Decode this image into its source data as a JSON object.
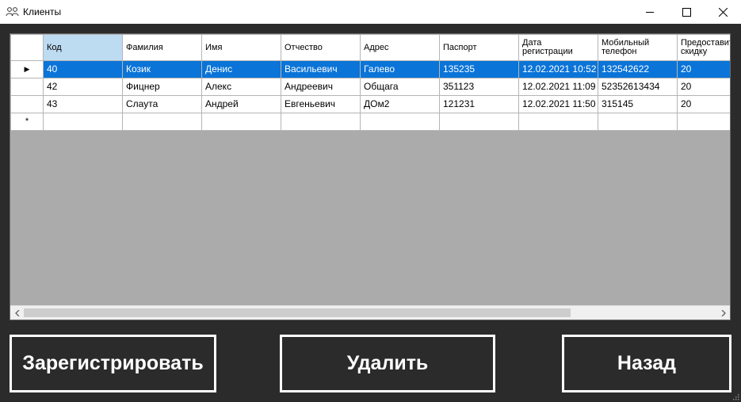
{
  "window": {
    "title": "Клиенты",
    "app_icon": "users-icon",
    "controls": [
      "minimize-icon",
      "maximize-icon",
      "close-icon"
    ]
  },
  "grid": {
    "columns": [
      "Код",
      "Фамилия",
      "Имя",
      "Отчество",
      "Адрес",
      "Паспорт",
      "Дата регистрации",
      "Мобильный телефон",
      "Предоставить скидку"
    ],
    "column_header_display": [
      "Код",
      "Фамилия",
      "Имя",
      "Отчество",
      "Адрес",
      "Паспорт",
      "Дата\nрегистрации",
      "Мобильный\nтелефон",
      "Предоставить\nскидку"
    ],
    "rows": [
      [
        "40",
        "Козик",
        "Денис",
        "Васильевич",
        "Галево",
        "135235",
        "12.02.2021 10:52",
        "132542622",
        "20"
      ],
      [
        "42",
        "Фицнер",
        "Алекс",
        "Андреевич",
        "Общага",
        "351123",
        "12.02.2021 11:09",
        "52352613434",
        "20"
      ],
      [
        "43",
        "Слаута",
        "Андрей",
        "Евгеньевич",
        "ДОм2",
        "121231",
        "12.02.2021 11:50",
        "315145",
        "20"
      ]
    ],
    "selected_row": 0,
    "current_row_marker": "▶",
    "new_row_marker": "*"
  },
  "buttons": {
    "register": "Зарегистрировать",
    "delete": "Удалить",
    "back": "Назад"
  },
  "colors": {
    "background": "#2b2b2b",
    "selection": "#0a74d8",
    "selected_header": "#bddcf2"
  }
}
